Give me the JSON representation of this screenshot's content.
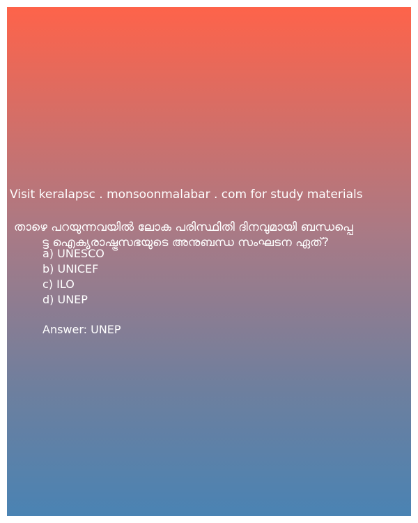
{
  "site_note": "Visit keralapsc . monsoonmalabar . com for study materials",
  "question": {
    "line1": "താഴെ പറയുന്നവയിൽ ലോക പരിസ്ഥിതി ദിനവുമായി ബന്ധപ്പെ",
    "line2": "ട്ട ഐക്യരാഷ്ട്രസഭയുടെ അനുബന്ധ സംഘടന ഏത്?"
  },
  "options": [
    "a) UNESCO",
    "b) UNICEF",
    "c) ILO",
    "d) UNEP"
  ],
  "answer": "Answer: UNEP",
  "colors": {
    "gradient_top": "#fe634a",
    "gradient_bottom": "#4a83b3",
    "text": "#ffffff"
  }
}
